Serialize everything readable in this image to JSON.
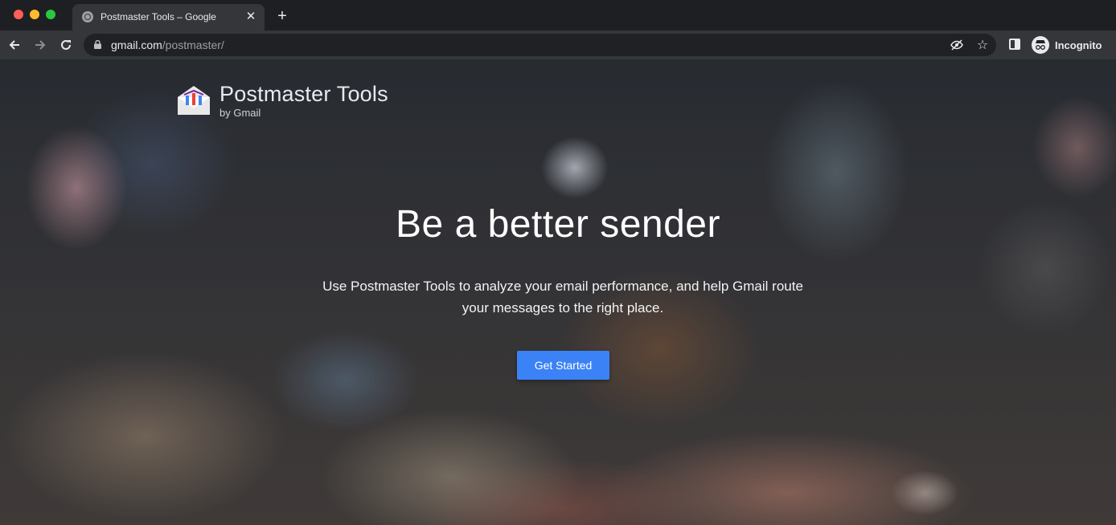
{
  "browser": {
    "tab": {
      "title": "Postmaster Tools – Google",
      "favicon": "globe-icon"
    },
    "url": {
      "host": "gmail.com",
      "path": "/postmaster/"
    },
    "profile_label": "Incognito"
  },
  "brand": {
    "title": "Postmaster Tools",
    "subtitle": "by Gmail"
  },
  "hero": {
    "headline": "Be a better sender",
    "subtext": "Use Postmaster Tools to analyze your email performance, and help Gmail route your messages to the right place.",
    "cta_label": "Get Started"
  },
  "colors": {
    "cta": "#3b82f6",
    "chrome_bg": "#35363a",
    "tabstrip_bg": "#1e1f22"
  }
}
